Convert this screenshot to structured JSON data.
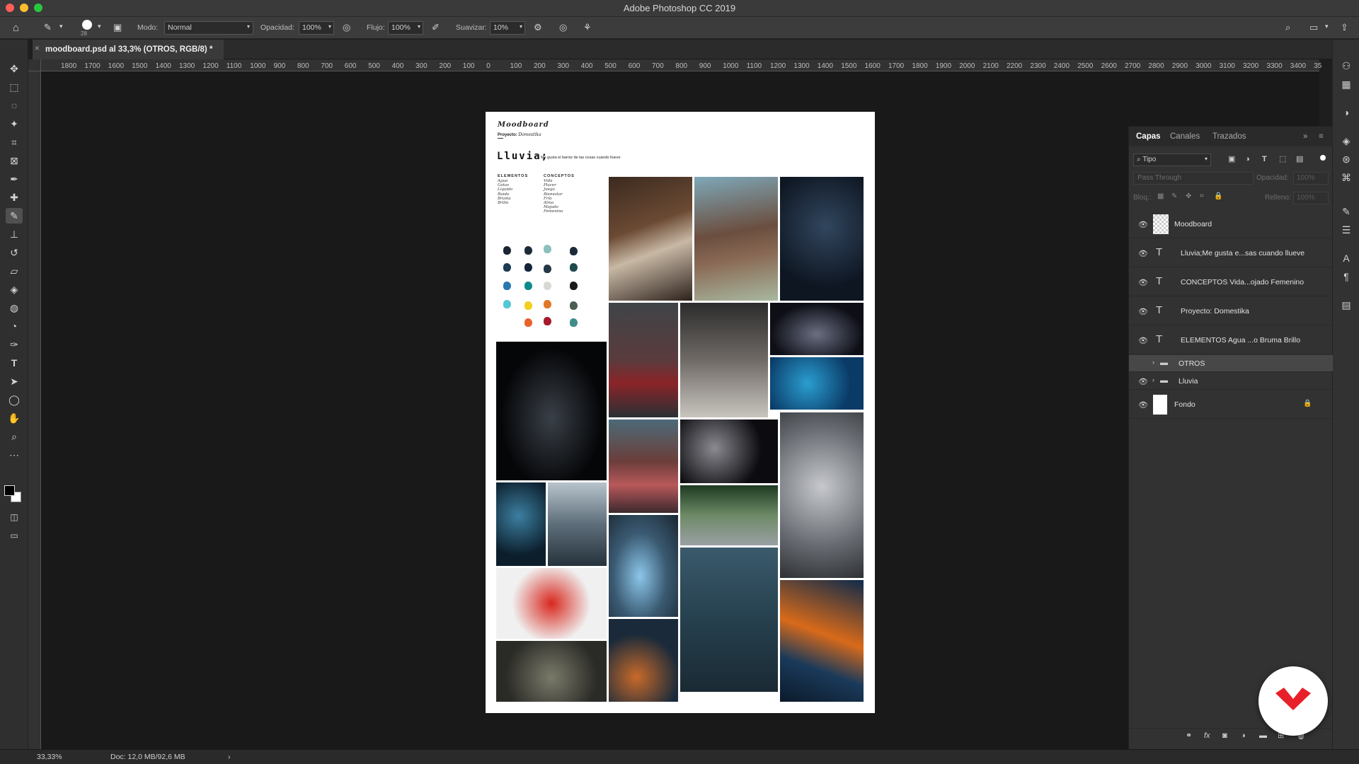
{
  "app": {
    "title": "Adobe Photoshop CC 2019"
  },
  "options_bar": {
    "brush_size": "28",
    "mode_label": "Modo:",
    "mode_value": "Normal",
    "opacity_label": "Opacidad:",
    "opacity_value": "100%",
    "flow_label": "Flujo:",
    "flow_value": "100%",
    "smoothing_label": "Suavizar:",
    "smoothing_value": "10%"
  },
  "document_tab": {
    "title": "moodboard.psd al 33,3% (OTROS, RGB/8) *"
  },
  "ruler_labels": [
    "1800",
    "1700",
    "1600",
    "1500",
    "1400",
    "1300",
    "1200",
    "1100",
    "1000",
    "900",
    "800",
    "700",
    "600",
    "500",
    "400",
    "300",
    "200",
    "100",
    "0",
    "100",
    "200",
    "300",
    "400",
    "500",
    "600",
    "700",
    "800",
    "900",
    "1000",
    "1100",
    "1200",
    "1300",
    "1400",
    "1500",
    "1600",
    "1700",
    "1800",
    "1900",
    "2000",
    "2100",
    "2200",
    "2300",
    "2400",
    "2500",
    "2600",
    "2700",
    "2800",
    "2900",
    "3000",
    "3100",
    "3200",
    "3300",
    "3400",
    "35"
  ],
  "moodboard": {
    "title": "Moodboard",
    "project_label": "Proyecto:",
    "project_value": "Domestika",
    "heading": "Lluvia;",
    "subheading": "Me gusta el barniz de las cosas cuando llueve",
    "elements_title": "ELEMENTOS",
    "elements": [
      "Agua",
      "Gotas",
      "Líquido",
      "Ruido",
      "Bruma",
      "Brillo"
    ],
    "concepts_title": "CONCEPTOS",
    "concepts": [
      "Vida",
      "Placer",
      "Juego",
      "Bienestar",
      "Frío",
      "Alma",
      "Mojado",
      "Femenino"
    ]
  },
  "colors": {
    "accent_red": "#e8202a",
    "swatches": [
      "#1a2433",
      "#1d2a3a",
      "#8cbfbd",
      "#1a2a38",
      "#1e3b55",
      "#14243a",
      "#243848",
      "#1f4a4e",
      "#2a78b0",
      "#0f8a8a",
      "#d9d9d4",
      "#1a1a1a",
      "#55c8d6",
      "#f2cf1c",
      "#e2772a",
      "#4b5e52",
      "#e8632a",
      "#a51b2b",
      "#3f8d88"
    ]
  },
  "layers_panel": {
    "tabs": [
      "Capas",
      "Canales",
      "Trazados"
    ],
    "filter_kind": "Tipo",
    "blend_mode": "Pass Through",
    "opacity_label": "Opacidad:",
    "opacity_value": "100%",
    "lock_label": "Bloq.:",
    "fill_label": "Relleno:",
    "fill_value": "100%",
    "layers": [
      {
        "name": "Moodboard",
        "kind": "pixel"
      },
      {
        "name": "Lluvia;Me gusta e...sas cuando llueve",
        "kind": "text"
      },
      {
        "name": "CONCEPTOS Vida...ojado Femenino",
        "kind": "text"
      },
      {
        "name": "Proyecto: Domestika",
        "kind": "text"
      },
      {
        "name": "ELEMENTOS Agua ...o Bruma Brillo",
        "kind": "text"
      },
      {
        "name": "OTROS",
        "kind": "group"
      },
      {
        "name": "Lluvia",
        "kind": "group"
      },
      {
        "name": "Fondo",
        "kind": "background"
      }
    ]
  },
  "status_bar": {
    "zoom": "33,33%",
    "doc_info": "Doc: 12,0 MB/92,6 MB"
  }
}
